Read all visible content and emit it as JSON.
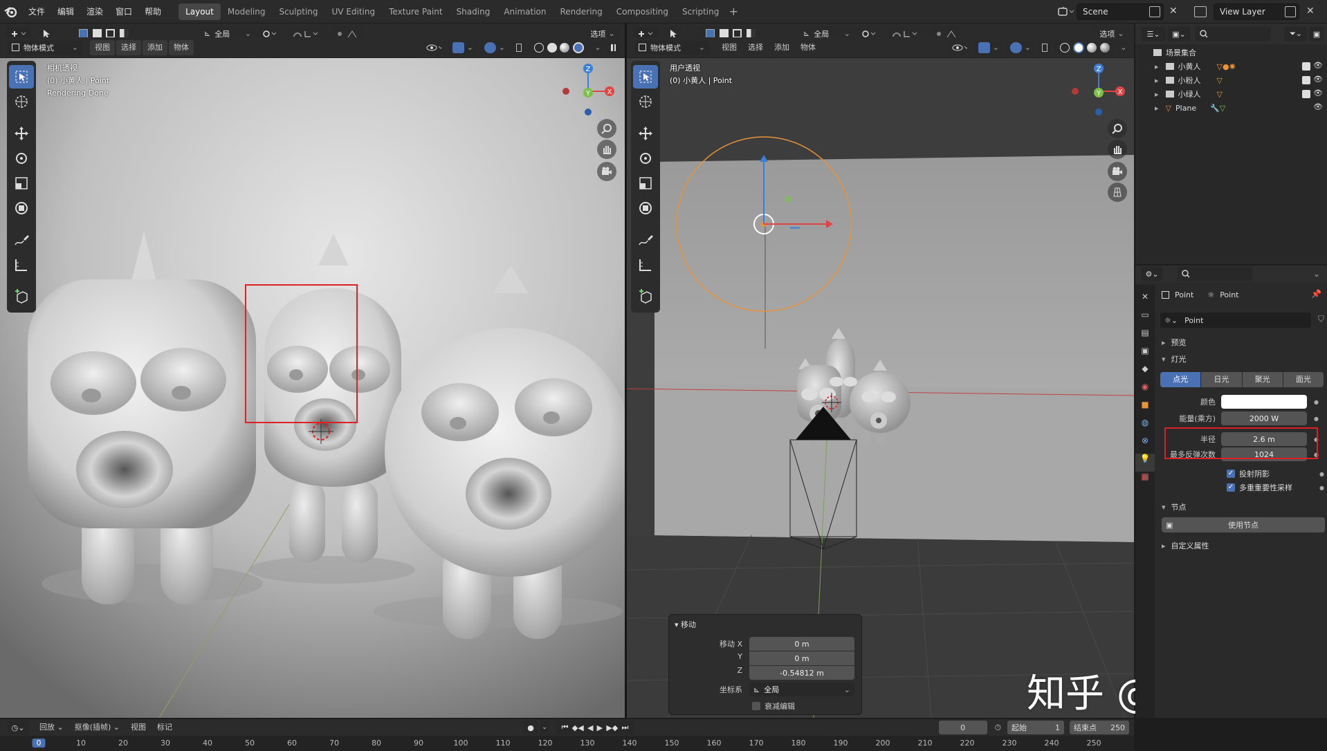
{
  "top_menu": {
    "items": [
      "文件",
      "编辑",
      "渲染",
      "窗口",
      "帮助"
    ]
  },
  "workspaces": {
    "tabs": [
      "Layout",
      "Modeling",
      "Sculpting",
      "UV Editing",
      "Texture Paint",
      "Shading",
      "Animation",
      "Rendering",
      "Compositing",
      "Scripting"
    ],
    "active": "Layout",
    "add": "+"
  },
  "scene": {
    "name": "Scene",
    "view_layer": "View Layer"
  },
  "viewport_common": {
    "transform_orientation": "全局",
    "options": "选项",
    "mode": "物体模式",
    "menus": [
      "视图",
      "选择",
      "添加",
      "物体"
    ]
  },
  "left_viewport": {
    "info": [
      "相机透视",
      "(0) 小黄人 | Point",
      "Rendering Done"
    ]
  },
  "right_viewport": {
    "info": [
      "用户透视",
      "(0) 小黄人 | Point"
    ]
  },
  "gizmo": {
    "x": "X",
    "y": "Y",
    "z": "Z"
  },
  "move_panel": {
    "title": "移动",
    "x_label": "移动 X",
    "x_value": "0 m",
    "y_label": "Y",
    "y_value": "0 m",
    "z_label": "Z",
    "z_value": "-0.54812 m",
    "orient_label": "坐标系",
    "orient_value": "全局",
    "proportional_label": "衰减编辑"
  },
  "outliner": {
    "root": "场景集合",
    "items": [
      {
        "name": "小黄人"
      },
      {
        "name": "小粉人"
      },
      {
        "name": "小绿人"
      },
      {
        "name": "Plane"
      }
    ]
  },
  "properties": {
    "breadcrumb_object": "Point",
    "breadcrumb_data": "Point",
    "datablock": "Point",
    "preview": "预览",
    "light": "灯光",
    "light_types": [
      "点光",
      "日光",
      "聚光",
      "面光"
    ],
    "active_light_type": "点光",
    "color_label": "颜色",
    "color_value": "#ffffff",
    "power_label": "能量(乘方)",
    "power_value": "2000 W",
    "radius_label": "半径",
    "radius_value": "2.6 m",
    "max_bounces_label": "最多反弹次数",
    "max_bounces_value": "1024",
    "cast_shadow": "投射阴影",
    "multiple_importance": "多重重要性采样",
    "nodes": "节点",
    "use_nodes": "使用节点",
    "custom_props": "自定义属性"
  },
  "timeline": {
    "menus": [
      "回放",
      "抠像(插帧)",
      "视图",
      "标记"
    ],
    "current_frame": "0",
    "start_label": "起始",
    "start": "1",
    "end_label": "结束点",
    "end": "250",
    "ticks": [
      "0",
      "10",
      "20",
      "30",
      "40",
      "50",
      "60",
      "70",
      "80",
      "90",
      "100",
      "110",
      "120",
      "130",
      "140",
      "150",
      "160",
      "170",
      "180",
      "190",
      "200",
      "210",
      "220",
      "230",
      "240",
      "250"
    ]
  },
  "watermark": "知乎 @lynnyin",
  "colors": {
    "accent": "#4a71b3",
    "highlight": "#e02020",
    "light_ring": "#e8923a"
  }
}
